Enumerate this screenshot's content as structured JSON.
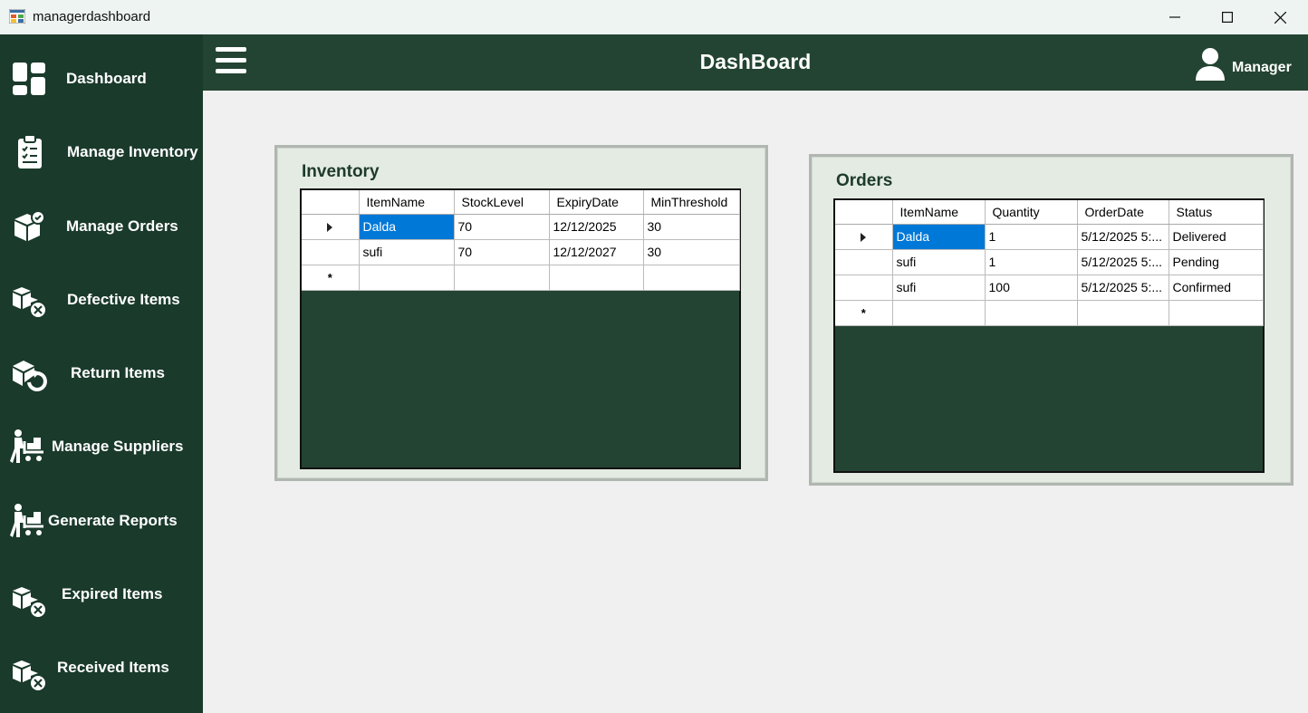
{
  "window": {
    "title": "managerdashboard",
    "minimize_glyph": "—",
    "maximize_glyph": "☐",
    "close_glyph": "✕"
  },
  "sidebar": {
    "items": [
      {
        "label": "Dashboard",
        "icon": "dashboard-icon"
      },
      {
        "label": "Manage Inventory",
        "icon": "clipboard-checklist-icon"
      },
      {
        "label": "Manage Orders",
        "icon": "box-check-icon"
      },
      {
        "label": "Defective Items",
        "icon": "boxes-x-icon"
      },
      {
        "label": "Return Items",
        "icon": "box-return-icon"
      },
      {
        "label": "Manage Suppliers",
        "icon": "person-cart-icon"
      },
      {
        "label": "Generate Reports",
        "icon": "person-cart-icon"
      },
      {
        "label": "Expired Items",
        "icon": "boxes-x-icon"
      },
      {
        "label": "Received Items",
        "icon": "boxes-x-icon"
      }
    ]
  },
  "header": {
    "title": "DashBoard",
    "user": "Manager"
  },
  "inventory": {
    "title": "Inventory",
    "columns": [
      "ItemName",
      "StockLevel",
      "ExpiryDate",
      "MinThreshold"
    ],
    "rows": [
      [
        "Dalda",
        "70",
        "12/12/2025",
        "30"
      ],
      [
        "sufi",
        "70",
        "12/12/2027",
        "30"
      ]
    ],
    "new_row_marker": "*"
  },
  "orders": {
    "title": "Orders",
    "columns": [
      "ItemName",
      "Quantity",
      "OrderDate",
      "Status"
    ],
    "rows": [
      [
        "Dalda",
        "1",
        "5/12/2025 5:...",
        "Delivered"
      ],
      [
        "sufi",
        "1",
        "5/12/2025 5:...",
        "Pending"
      ],
      [
        "sufi",
        "100",
        "5/12/2025 5:...",
        "Confirmed"
      ]
    ],
    "new_row_marker": "*"
  },
  "colors": {
    "sidebar": "#1a3a2b",
    "header": "#234432",
    "selection": "#0078d7"
  }
}
